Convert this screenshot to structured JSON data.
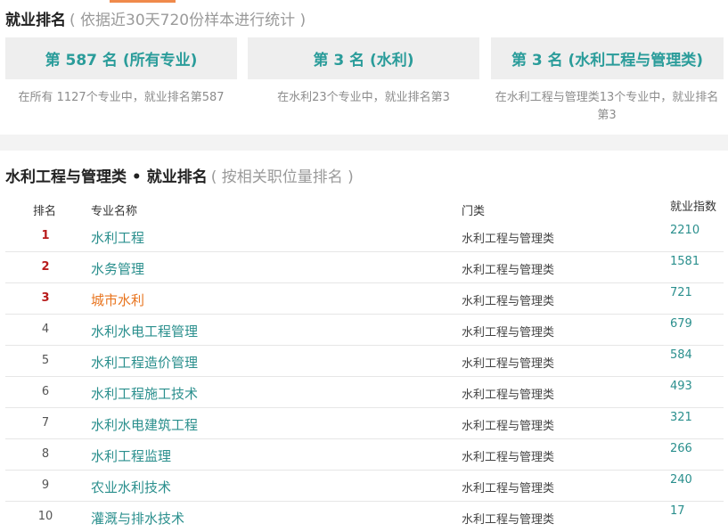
{
  "stats": {
    "title": "就业排名",
    "subtitle": "( 依据近30天720份样本进行统计 )",
    "cards": [
      {
        "label": "第 587 名 (所有专业)",
        "desc": "在所有 1127个专业中，就业排名第587"
      },
      {
        "label": "第 3 名 (水利)",
        "desc": "在水利23个专业中，就业排名第3"
      },
      {
        "label": "第 3 名 (水利工程与管理类)",
        "desc": "在水利工程与管理类13个专业中，就业排名第3"
      }
    ]
  },
  "ranking": {
    "title": "水利工程与管理类 • 就业排名",
    "subtitle": "( 按相关职位量排名 )",
    "headers": {
      "rank": "排名",
      "name": "专业名称",
      "category": "门类",
      "index": "就业指数"
    },
    "rows": [
      {
        "rank": "1",
        "name": "水利工程",
        "category": "水利工程与管理类",
        "index": "2210"
      },
      {
        "rank": "2",
        "name": "水务管理",
        "category": "水利工程与管理类",
        "index": "1581"
      },
      {
        "rank": "3",
        "name": "城市水利",
        "category": "水利工程与管理类",
        "index": "721"
      },
      {
        "rank": "4",
        "name": "水利水电工程管理",
        "category": "水利工程与管理类",
        "index": "679"
      },
      {
        "rank": "5",
        "name": "水利工程造价管理",
        "category": "水利工程与管理类",
        "index": "584"
      },
      {
        "rank": "6",
        "name": "水利工程施工技术",
        "category": "水利工程与管理类",
        "index": "493"
      },
      {
        "rank": "7",
        "name": "水利水电建筑工程",
        "category": "水利工程与管理类",
        "index": "321"
      },
      {
        "rank": "8",
        "name": "水利工程监理",
        "category": "水利工程与管理类",
        "index": "266"
      },
      {
        "rank": "9",
        "name": "农业水利技术",
        "category": "水利工程与管理类",
        "index": "240"
      },
      {
        "rank": "10",
        "name": "灌溉与排水技术",
        "category": "水利工程与管理类",
        "index": "17"
      }
    ]
  },
  "colors": {
    "accent_teal": "#2a9c9a",
    "link_teal": "#2a8f8d",
    "highlight_orange": "#e8741e",
    "top_rank_red": "#b81c1c",
    "tab_accent": "#f08a4b"
  }
}
